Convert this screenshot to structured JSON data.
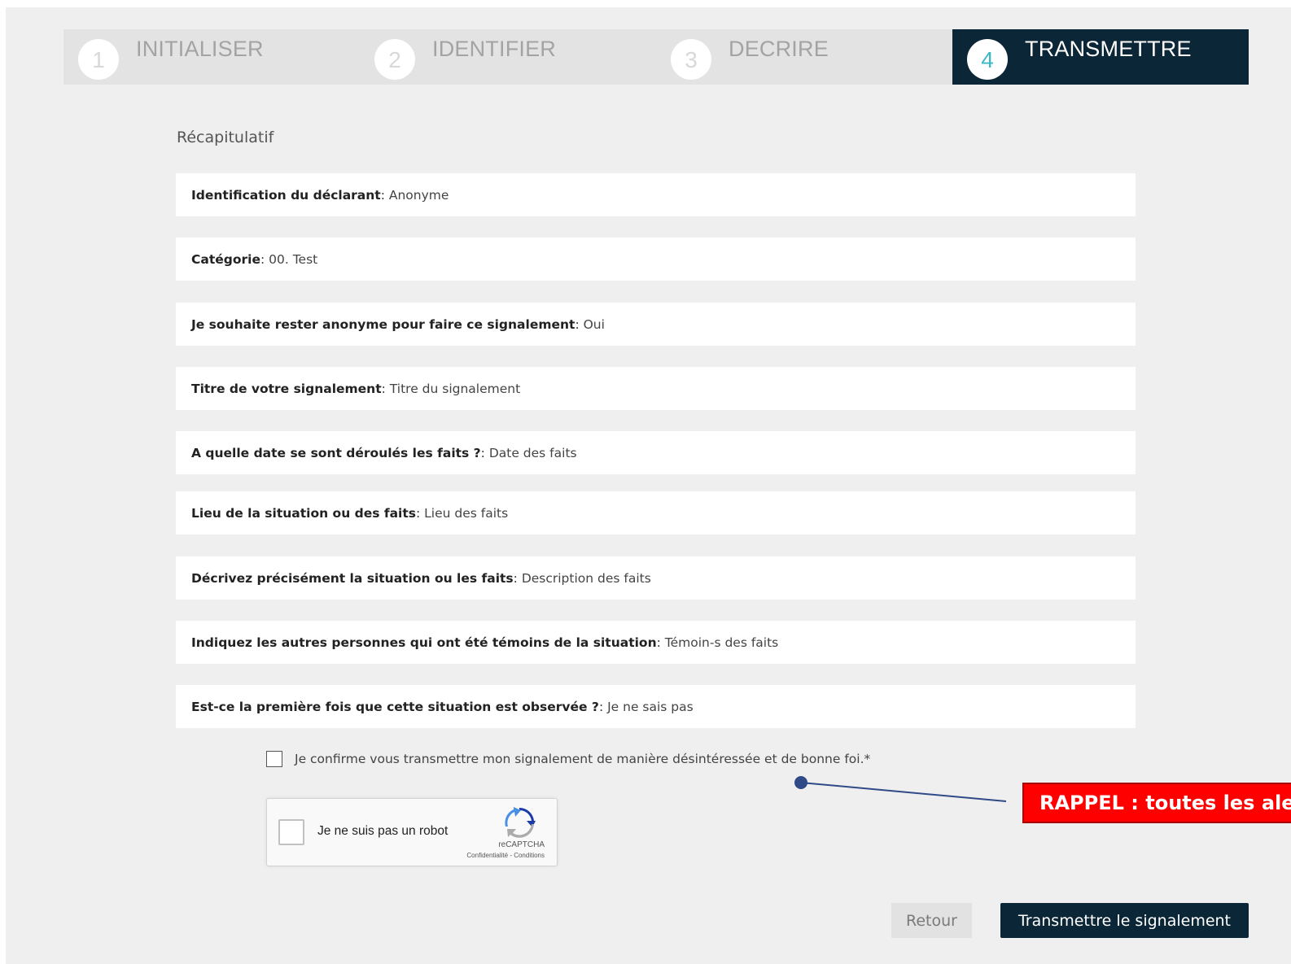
{
  "stepper": {
    "steps": [
      {
        "number": "1",
        "label": "INITIALISER"
      },
      {
        "number": "2",
        "label": "IDENTIFIER"
      },
      {
        "number": "3",
        "label": "DECRIRE"
      },
      {
        "number": "4",
        "label": "TRANSMETTRE"
      }
    ],
    "active_step": "4"
  },
  "recap": {
    "title": "Récapitulatif",
    "rows": [
      {
        "key": "Identification du déclarant",
        "value": "Anonyme"
      },
      {
        "key": "Catégorie",
        "value": "00. Test"
      },
      {
        "key": "Je souhaite rester anonyme pour faire ce signalement",
        "value": "Oui"
      },
      {
        "key": "Titre de votre signalement",
        "value": "Titre du signalement"
      },
      {
        "key": "A quelle date se sont déroulés les faits ?",
        "value": "Date des faits"
      },
      {
        "key": "Lieu de la situation ou des faits",
        "value": "Lieu des faits"
      },
      {
        "key": "Décrivez précisément la situation ou les faits",
        "value": "Description des faits"
      },
      {
        "key": "Indiquez les autres personnes qui ont été témoins de la situation",
        "value": "Témoin-s des faits"
      },
      {
        "key": "Est-ce la première fois que cette situation est observée ?",
        "value": "Je ne sais pas"
      }
    ],
    "separator": ": "
  },
  "confirm": {
    "label": "Je confirme vous transmettre mon signalement de manière désintéressée et de bonne foi.*",
    "checked": false
  },
  "captcha": {
    "label": "Je ne suis pas un robot",
    "brand": "reCAPTCHA",
    "links": "Confidentialité - Conditions"
  },
  "annotation": {
    "text": "RAPPEL : toutes les alertes",
    "color": "#ff0000"
  },
  "buttons": {
    "back": "Retour",
    "submit": "Transmettre le signalement"
  },
  "colors": {
    "dark": "#0b2636",
    "accent": "#3fb7c9",
    "background": "#efefef"
  },
  "icons": {
    "captcha_logo": "recaptcha-logo-icon",
    "checkbox": "checkbox-icon"
  }
}
